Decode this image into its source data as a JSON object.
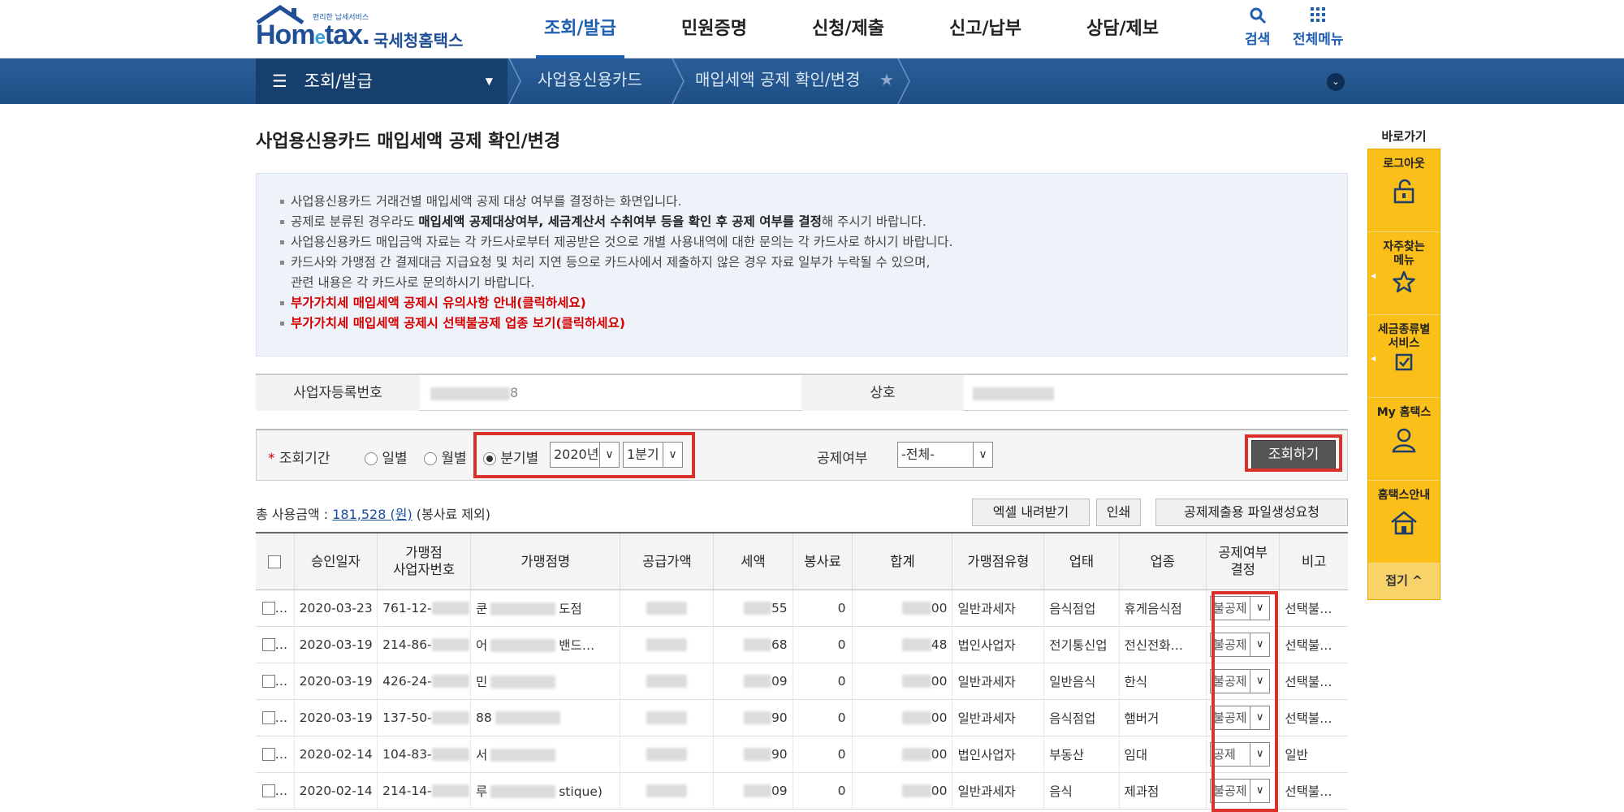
{
  "header": {
    "logo_sub": "편리한 납세서비스",
    "logo_main": "Hometax.",
    "logo_kr": "국세청홈택스",
    "nav": [
      "조회/발급",
      "민원증명",
      "신청/제출",
      "신고/납부",
      "상담/제보"
    ],
    "active_nav": "조회/발급",
    "search_label": "검색",
    "allmenu_label": "전체메뉴"
  },
  "locbar": {
    "home": "조회/발급",
    "crumbs": [
      "사업용신용카드",
      "매입세액 공제 확인/변경"
    ]
  },
  "page": {
    "title": "사업용신용카드 매입세액 공제 확인/변경"
  },
  "notice": {
    "l1": "사업용신용카드 거래건별 매입세액 공제 대상 여부를 결정하는 화면입니다.",
    "l2a": "공제로 분류된 경우라도 ",
    "l2b": "매입세액 공제대상여부, 세금계산서 수취여부 등을 확인 후 공제 여부를 결정",
    "l2c": "해 주시기 바랍니다.",
    "l3": "사업용신용카드 매입금액 자료는 각 카드사로부터 제공받은 것으로 개별 사용내역에 대한 문의는 각 카드사로 하시기 바랍니다.",
    "l4": "카드사와 가맹점 간 결제대금 지급요청 및 처리 지연 등으로 카드사에서 제출하지 않은 경우 자료 일부가 누락될 수 있으며,",
    "l5": "관련 내용은 각 카드사로 문의하시기 바랍니다.",
    "link1": "부가가치세 매입세액 공제시 유의사항 안내(클릭하세요)",
    "link2": "부가가치세 매입세액 공제시 선택불공제 업종 보기(클릭하세요)"
  },
  "biz": {
    "reg_label": "사업자등록번호",
    "reg_value_tail": "8",
    "name_label": "상호"
  },
  "search": {
    "period_label": "조회기간",
    "daily": "일별",
    "monthly": "월별",
    "quarterly": "분기별",
    "year": "2020년",
    "quarter": "1분기",
    "deduct_label": "공제여부",
    "deduct_value": "-전체-",
    "query_btn": "조회하기"
  },
  "summary": {
    "prefix": "총 사용금액 : ",
    "amount": "181,528 (원)",
    "suffix": " (봉사료 제외)",
    "excel_btn": "엑셀 내려받기",
    "print_btn": "인쇄",
    "file_btn": "공제제출용 파일생성요청"
  },
  "table": {
    "headers": [
      "",
      "승인일자",
      "가맹점\n사업자번호",
      "가맹점명",
      "공급가액",
      "세액",
      "봉사료",
      "합계",
      "가맹점유형",
      "업태",
      "업종",
      "공제여부\n결정",
      "비고"
    ],
    "rows": [
      {
        "date": "2020-03-23",
        "bizno": "761-12-",
        "name_pre": "쿤",
        "name_post": "도점",
        "tax": "55",
        "svc": "0",
        "total": "00",
        "type": "일반과세자",
        "biz": "음식점업",
        "item": "휴게음식점",
        "decision": "불공제",
        "note": "선택불…"
      },
      {
        "date": "2020-03-19",
        "bizno": "214-86-",
        "name_pre": "어",
        "name_post": "밴드…",
        "tax": "68",
        "svc": "0",
        "total": "48",
        "type": "법인사업자",
        "biz": "전기통신업",
        "item": "전신전화…",
        "decision": "불공제",
        "note": "선택불…"
      },
      {
        "date": "2020-03-19",
        "bizno": "426-24-",
        "name_pre": "민",
        "name_post": "",
        "tax": "09",
        "svc": "0",
        "total": "00",
        "type": "일반과세자",
        "biz": "일반음식",
        "item": "한식",
        "decision": "불공제",
        "note": "선택불…"
      },
      {
        "date": "2020-03-19",
        "bizno": "137-50-",
        "name_pre": "88",
        "name_post": "",
        "tax": "90",
        "svc": "0",
        "total": "00",
        "type": "일반과세자",
        "biz": "음식점업",
        "item": "햄버거",
        "decision": "불공제",
        "note": "선택불…"
      },
      {
        "date": "2020-02-14",
        "bizno": "104-83-",
        "name_pre": "서",
        "name_post": "",
        "tax": "90",
        "svc": "0",
        "total": "00",
        "type": "법인사업자",
        "biz": "부동산",
        "item": "임대",
        "decision": "공제",
        "note": "일반"
      },
      {
        "date": "2020-02-14",
        "bizno": "214-14-",
        "name_pre": "루",
        "name_post": "stique)",
        "tax": "09",
        "svc": "0",
        "total": "00",
        "type": "일반과세자",
        "biz": "음식",
        "item": "제과점",
        "decision": "불공제",
        "note": "선택불…"
      }
    ]
  },
  "quick": {
    "title": "바로가기",
    "items": [
      {
        "label": "로그아웃",
        "icon": "unlock-icon"
      },
      {
        "label": "자주찾는\n메뉴",
        "icon": "star-icon"
      },
      {
        "label": "세금종류별\n서비스",
        "icon": "check-icon"
      },
      {
        "label": "My 홈택스",
        "icon": "person-icon"
      },
      {
        "label": "홈택스안내",
        "icon": "home-icon"
      }
    ],
    "fold": "접기"
  },
  "colors": {
    "accent": "#1f5fb2",
    "nav_bar": "#1e4f86",
    "highlight": "#d9322b",
    "quick_panel": "#fbbf1a"
  }
}
